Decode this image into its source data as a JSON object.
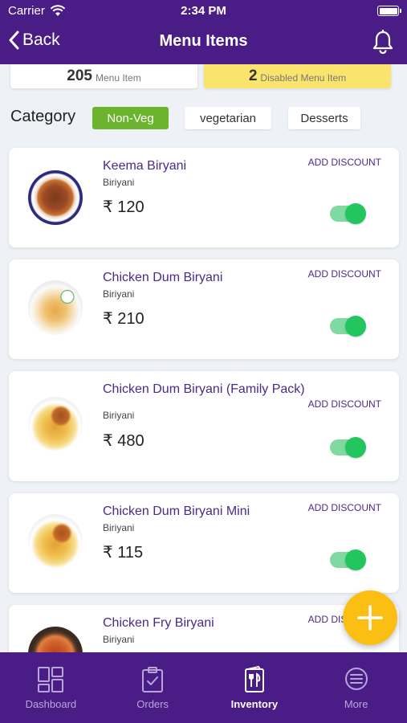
{
  "status_bar": {
    "carrier": "Carrier",
    "time": "2:34 PM"
  },
  "nav": {
    "back_label": "Back",
    "title": "Menu Items"
  },
  "summary": {
    "total_count": "205",
    "total_label": "Menu Item",
    "disabled_count": "2",
    "disabled_label": "Disabled Menu Item"
  },
  "category": {
    "label": "Category",
    "chips": [
      {
        "label": "Non-Veg",
        "active": true
      },
      {
        "label": "vegetarian",
        "active": false
      },
      {
        "label": "Desserts",
        "active": false
      }
    ]
  },
  "currency_symbol": "₹",
  "items": [
    {
      "name": "Keema Biryani",
      "category": "Biriyani",
      "price": "₹ 120",
      "discount_label": "ADD DISCOUNT",
      "enabled": true,
      "image": "keema-biryani-image"
    },
    {
      "name": "Chicken Dum Biryani",
      "category": "Biriyani",
      "price": "₹ 210",
      "discount_label": "ADD DISCOUNT",
      "enabled": true,
      "image": "chicken-dum-biryani-image"
    },
    {
      "name": "Chicken Dum Biryani (Family Pack)",
      "category": "Biriyani",
      "price": "₹ 480",
      "discount_label": "ADD DISCOUNT",
      "enabled": true,
      "image": "family-pack-biryani-image"
    },
    {
      "name": "Chicken Dum Biryani Mini",
      "category": "Biriyani",
      "price": "₹ 115",
      "discount_label": "ADD DISCOUNT",
      "enabled": true,
      "image": "mini-biryani-image"
    },
    {
      "name": "Chicken Fry Biryani",
      "category": "Biriyani",
      "price": "",
      "discount_label": "ADD DISCOUNT",
      "enabled": true,
      "image": "chicken-fry-biryani-image"
    }
  ],
  "tabs": [
    {
      "label": "Dashboard",
      "icon": "dashboard-icon",
      "active": false
    },
    {
      "label": "Orders",
      "icon": "clipboard-icon",
      "active": false
    },
    {
      "label": "Inventory",
      "icon": "menu-card-icon",
      "active": true
    },
    {
      "label": "More",
      "icon": "more-icon",
      "active": false
    }
  ],
  "colors": {
    "primary": "#4a1d86",
    "active_chip": "#6ab42e",
    "toggle_on": "#22c55e",
    "fab": "#fbbf14",
    "disabled_card": "#fbe46e"
  }
}
